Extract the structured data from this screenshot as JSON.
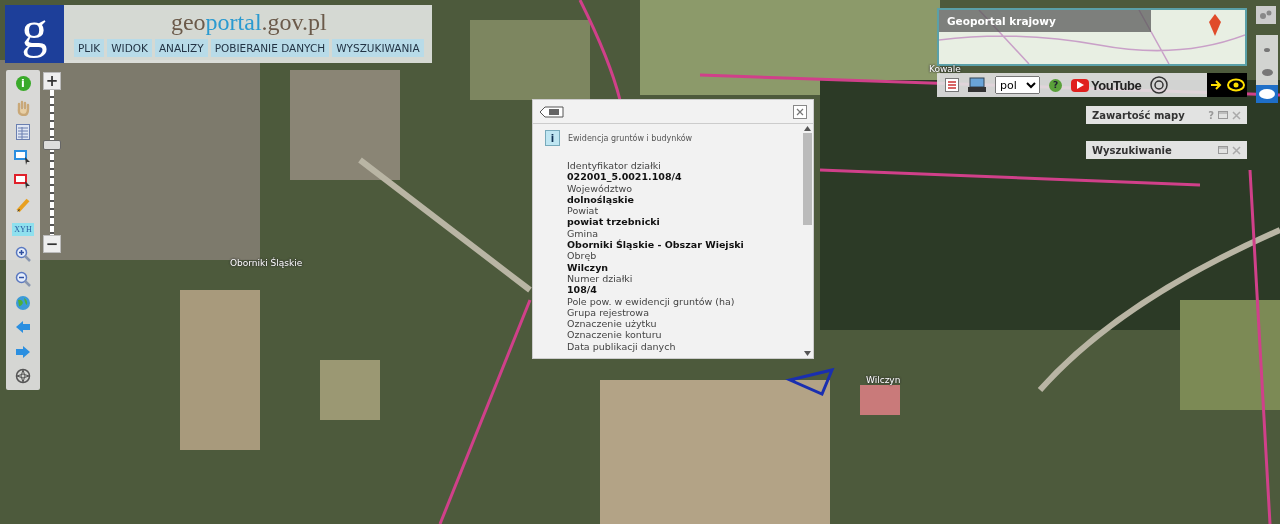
{
  "header": {
    "logo": "g",
    "site": {
      "part1": "geo",
      "part2": "portal",
      "part3": ".gov.pl"
    },
    "menu": [
      {
        "label": "PLIK"
      },
      {
        "label": "WIDOK"
      },
      {
        "label": "ANALIZY"
      },
      {
        "label": "POBIERANIE DANYCH"
      },
      {
        "label": "WYSZUKIWANIA"
      }
    ]
  },
  "toolbar": {
    "tools": [
      {
        "kind": "info",
        "label": "i"
      },
      {
        "kind": "pan"
      },
      {
        "kind": "table"
      },
      {
        "kind": "select-blue"
      },
      {
        "kind": "select-red"
      },
      {
        "kind": "pencil"
      },
      {
        "kind": "xyh",
        "label": "XYH"
      },
      {
        "kind": "zoom-in"
      },
      {
        "kind": "zoom-out"
      },
      {
        "kind": "globe"
      },
      {
        "kind": "back"
      },
      {
        "kind": "forward"
      },
      {
        "kind": "compass"
      }
    ]
  },
  "zoom": {
    "plus": "+",
    "minus": "−",
    "level": 0.63
  },
  "map_labels": [
    {
      "text": "Oborniki Śląskie",
      "kind": "town"
    },
    {
      "text": "Wilczyn",
      "kind": "village"
    },
    {
      "text": "Kowale",
      "kind": "overview"
    }
  ],
  "overview": {
    "title": "Geoportal krajowy"
  },
  "topbar": {
    "language": "pol",
    "help": "?",
    "youtube": "YouTube"
  },
  "scale_views": [
    {
      "selected": false
    },
    {
      "selected": false
    },
    {
      "selected": true
    }
  ],
  "panels": [
    {
      "title": "Zawartość mapy",
      "help": true,
      "help_label": "?"
    },
    {
      "title": "Wyszukiwanie",
      "help": false
    }
  ],
  "popup": {
    "icon": "i",
    "title": "Ewidencja gruntów i budynków",
    "fields": [
      {
        "label": "Identyfikator działki",
        "value": "022001_5.0021.108/4"
      },
      {
        "label": "Województwo",
        "value": "dolnośląskie"
      },
      {
        "label": "Powiat",
        "value": "powiat trzebnicki"
      },
      {
        "label": "Gmina",
        "value": "Oborniki Śląskie - Obszar Wiejski"
      },
      {
        "label": "Obręb",
        "value": "Wilczyn"
      },
      {
        "label": "Numer działki",
        "value": "108/4"
      },
      {
        "label": "Pole pow. w ewidencji gruntów (ha)"
      },
      {
        "label": "Grupa rejestrowa"
      },
      {
        "label": "Oznaczenie użytku"
      },
      {
        "label": "Oznaczenie konturu"
      },
      {
        "label": "Data publikacji danych"
      }
    ]
  }
}
